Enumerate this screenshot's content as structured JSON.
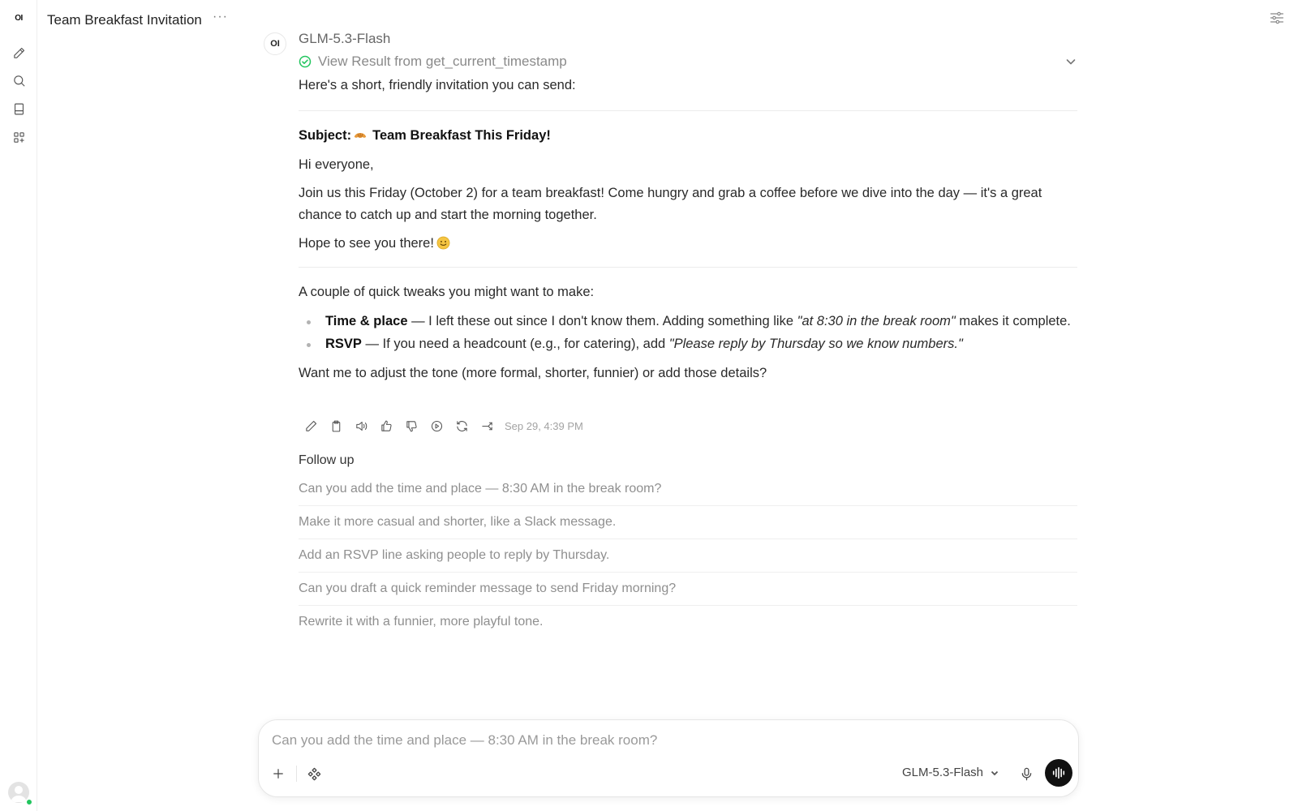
{
  "sidebar": {
    "logo": "OI",
    "items": [
      {
        "name": "new-chat",
        "icon": "pencil-icon"
      },
      {
        "name": "search",
        "icon": "search-icon"
      },
      {
        "name": "notes",
        "icon": "notebook-icon"
      },
      {
        "name": "workspace",
        "icon": "grid-plus-icon"
      }
    ],
    "user_status_color": "#22c55e"
  },
  "header": {
    "title": "Team Breakfast Invitation",
    "more_label": "···"
  },
  "message": {
    "avatar_text": "OI",
    "model": "GLM-5.3-Flash",
    "tool_result": "View Result from get_current_timestamp",
    "intro": "Here's a short, friendly invitation you can send:",
    "subject_prefix": "Subject:",
    "subject_text": "Team Breakfast This Friday!",
    "greeting": "Hi everyone,",
    "body": "Join us this Friday (October 2) for a team breakfast! Come hungry and grab a coffee before we dive into the day — it's a great chance to catch up and start the morning together.",
    "closing": "Hope to see you there!",
    "tweaks_intro": "A couple of quick tweaks you might want to make:",
    "tweaks": [
      {
        "label": "Time & place",
        "text_before": " — I left these out since I don't know them. Adding something like ",
        "example": "\"at 8:30 in the break room\"",
        "text_after": " makes it complete."
      },
      {
        "label": "RSVP",
        "text_before": " — If you need a headcount (e.g., for catering), add ",
        "example": "\"Please reply by Thursday so we know numbers.\"",
        "text_after": ""
      }
    ],
    "question": "Want me to adjust the tone (more formal, shorter, funnier) or add those details?",
    "timestamp": "Sep 29, 4:39 PM",
    "actions": [
      "edit-icon",
      "copy-icon",
      "speaker-icon",
      "thumbs-up-icon",
      "thumbs-down-icon",
      "play-icon",
      "regenerate-icon",
      "continue-icon"
    ]
  },
  "follow_up": {
    "title": "Follow up",
    "items": [
      "Can you add the time and place — 8:30 AM in the break room?",
      "Make it more casual and shorter, like a Slack message.",
      "Add an RSVP line asking people to reply by Thursday.",
      "Can you draft a quick reminder message to send Friday morning?",
      "Rewrite it with a funnier, more playful tone."
    ]
  },
  "composer": {
    "placeholder": "Can you add the time and place — 8:30 AM in the break room?",
    "model": "GLM-5.3-Flash"
  }
}
